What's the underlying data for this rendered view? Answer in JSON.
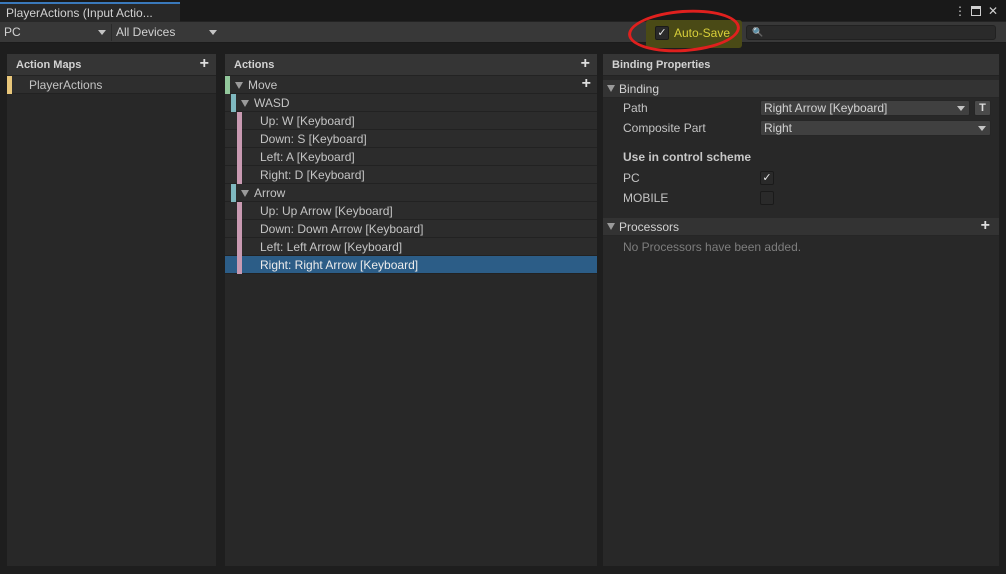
{
  "window": {
    "tab_title": "PlayerActions (Input Actio...",
    "controls": {
      "menu": "⋮",
      "close": "✕"
    }
  },
  "toolbar": {
    "control_scheme": "PC",
    "devices": "All Devices",
    "autosave_label": "Auto-Save",
    "autosave_checked": true,
    "search_value": ""
  },
  "action_maps": {
    "header": "Action Maps",
    "items": [
      {
        "label": "PlayerActions"
      }
    ]
  },
  "actions": {
    "header": "Actions",
    "rows": [
      {
        "label": "Move"
      },
      {
        "label": "WASD"
      },
      {
        "label": "Up: W [Keyboard]"
      },
      {
        "label": "Down: S [Keyboard]"
      },
      {
        "label": "Left: A [Keyboard]"
      },
      {
        "label": "Right: D [Keyboard]"
      },
      {
        "label": "Arrow"
      },
      {
        "label": "Up: Up Arrow [Keyboard]"
      },
      {
        "label": "Down: Down Arrow [Keyboard]"
      },
      {
        "label": "Left: Left Arrow [Keyboard]"
      },
      {
        "label": "Right: Right Arrow [Keyboard]"
      }
    ]
  },
  "binding_properties": {
    "header": "Binding Properties",
    "binding_section": "Binding",
    "path_label": "Path",
    "path_value": "Right Arrow [Keyboard]",
    "t_button": "T",
    "composite_label": "Composite Part",
    "composite_value": "Right",
    "scheme_heading": "Use in control scheme",
    "schemes": [
      {
        "label": "PC",
        "checked": true
      },
      {
        "label": "MOBILE",
        "checked": false
      }
    ],
    "processors_section": "Processors",
    "processors_empty": "No Processors have been added."
  },
  "colors": {
    "selection": "#2c5d87",
    "autosave_text": "#d8cf3a",
    "annotation_circle": "#e0201e",
    "map_bar": "#e8c67a",
    "action_bar": "#92c79b",
    "composite_bar": "#7fb8bf",
    "binding_bar": "#c99ab2"
  }
}
